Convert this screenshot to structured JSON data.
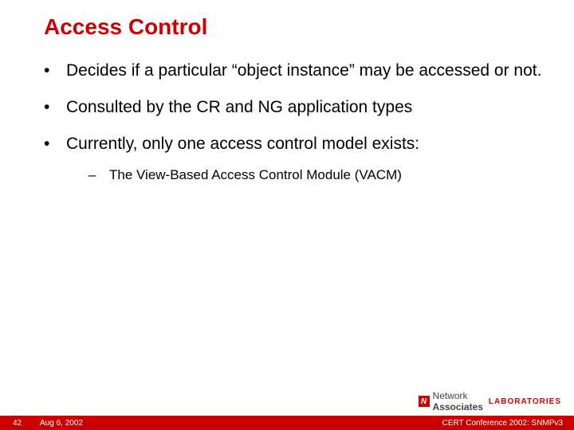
{
  "title": "Access Control",
  "bullets": [
    {
      "text": "Decides if a particular “object instance” may be accessed or not."
    },
    {
      "text": "Consulted by the CR and NG application types"
    },
    {
      "text": "Currently, only one access control model exists:",
      "sub": [
        "The View-Based Access Control Module (VACM)"
      ]
    }
  ],
  "footer": {
    "page": "42",
    "date": "Aug 6, 2002",
    "conference": "CERT Conference 2002: SNMPv3"
  },
  "logo": {
    "mark": "N",
    "brand_light": "Network",
    "brand_bold": "Associates",
    "labs": "LABORATORIES"
  }
}
